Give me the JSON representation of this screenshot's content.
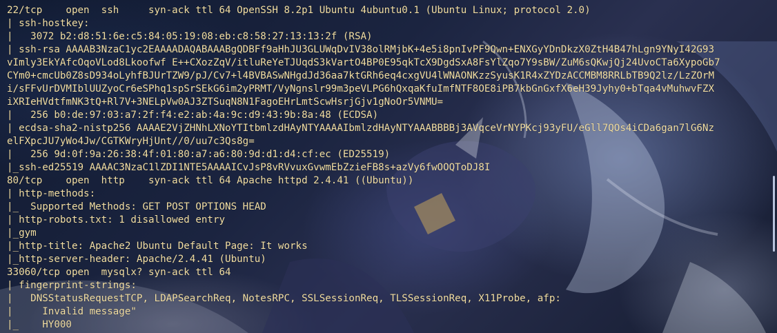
{
  "terminal": {
    "lines": [
      "22/tcp    open  ssh     syn-ack ttl 64 OpenSSH 8.2p1 Ubuntu 4ubuntu0.1 (Ubuntu Linux; protocol 2.0)",
      "| ssh-hostkey:",
      "|   3072 b2:d8:51:6e:c5:84:05:19:08:eb:c8:58:27:13:13:2f (RSA)",
      "| ssh-rsa AAAAB3NzaC1yc2EAAAADAQABAAABgQDBFf9aHhJU3GLUWqDvIV38olRMjbK+4e5i8pnIvPF9Qwn+ENXGyYDnDkzX0ZtH4B47hLgn9YNyI42G93",
      "vImly3EkYAfcOqoVLod8Lkoofwf E++CXozZqV/itluReYeTJUqdS3kVartO4BP0E95qkTcX9DgdSxA8FsYlZqo7Y9sBW/ZuM6sQKwjQj24UvoCTa6XypoGb7",
      "CYm0+cmcUb0Z8sD934oLyhfBJUrTZW9/pJ/Cv7+l4BVBASwNHgdJd36aa7ktGRh6eq4cxgVU4lWNAONKzzSyusK1R4xZYDzACCMBM8RRLbTB9Q2lz/LzZOrM",
      "i/sFFvUrDVMIblUUZyoCr6eSPhq1spSrSEkG6im2yPRMT/VyNgnslr99m3peVLPG6hQxqaKfuImfNTF8OE8iPB7kbGnGxfX6eH39Jyhy0+bTqa4vMuhwvFZX",
      "iXRIeHVdtfmNK3tQ+Rl7V+3NELpVw0AJ3ZTSuqN8N1FagoEHrLmtScwHsrjGjv1gNoOr5VNMU=",
      "|   256 b0:de:97:03:a7:2f:f4:e2:ab:4a:9c:d9:43:9b:8a:48 (ECDSA)",
      "| ecdsa-sha2-nistp256 AAAAE2VjZHNhLXNoYTItbmlzdHAyNTYAAAAIbmlzdHAyNTYAAABBBBj3AVqceVrNYPKcj93yFU/eGll7QOs4iCDa6gan7lG6Nz",
      "elFXpcJU7yWo4Jw/CGTKWryHjUnt//0/uu7c3Qs8g=",
      "|   256 9d:0f:9a:26:38:4f:01:80:a7:a6:80:9d:d1:d4:cf:ec (ED25519)",
      "|_ssh-ed25519 AAAAC3NzaC1lZDI1NTE5AAAAICvJsP8vRVvuxGvwmEbZzieFB8s+azVy6fwOOQToDJ8I",
      "80/tcp    open  http    syn-ack ttl 64 Apache httpd 2.4.41 ((Ubuntu))",
      "| http-methods:",
      "|_  Supported Methods: GET POST OPTIONS HEAD",
      "| http-robots.txt: 1 disallowed entry",
      "|_gym",
      "|_http-title: Apache2 Ubuntu Default Page: It works",
      "|_http-server-header: Apache/2.4.41 (Ubuntu)",
      "33060/tcp open  mysqlx? syn-ack ttl 64",
      "| fingerprint-strings:",
      "|   DNSStatusRequestTCP, LDAPSearchReq, NotesRPC, SSLSessionReq, TLSSessionReq, X11Probe, afp:",
      "|     Invalid message\"",
      "|_    HY000"
    ]
  },
  "colors": {
    "text": "#f3dfa4",
    "scrollbar": "#b9c4dd"
  }
}
